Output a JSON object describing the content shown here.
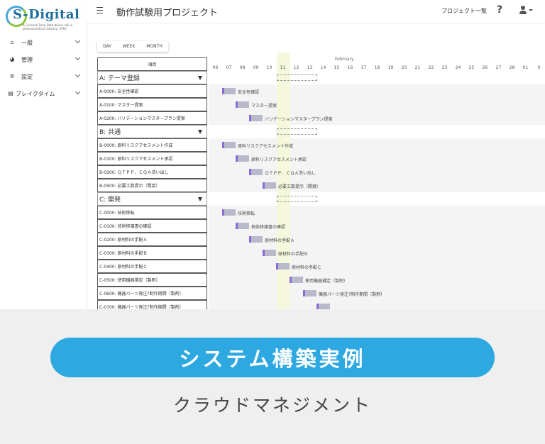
{
  "logo": {
    "text": "S-Digital",
    "tagline": "A Connect Tomo Data-driven eQi in pharmaceutical industry! (IFM)"
  },
  "sidebar": {
    "items": [
      {
        "label": "一般",
        "icon": "home-icon"
      },
      {
        "label": "管理",
        "icon": "palette-icon"
      },
      {
        "label": "設定",
        "icon": "gear-icon"
      },
      {
        "label": "ブレイクタイム",
        "icon": "book-icon"
      }
    ]
  },
  "header": {
    "title": "動作試験用プロジェクト",
    "project_list": "プロジェクト一覧",
    "help": "?"
  },
  "view": {
    "day": "DAY",
    "week": "WEEK",
    "month": "MONTH"
  },
  "table": {
    "header": "項目"
  },
  "month": "February",
  "days": [
    "06",
    "07",
    "08",
    "09",
    "10",
    "11",
    "12",
    "13",
    "14",
    "15",
    "16",
    "17",
    "18",
    "19",
    "20",
    "21",
    "22",
    "23",
    "24",
    "25",
    "26",
    "27",
    "28",
    "01",
    "0"
  ],
  "groups": [
    {
      "label": "A: テーマ登録",
      "tasks": [
        {
          "label": "A-0000: 安全性確認",
          "bar_label": "安全性確認"
        },
        {
          "label": "A-0100: マスター提案",
          "bar_label": "マスター提案"
        },
        {
          "label": "A-0200: バリデーションマスタープラン提案",
          "bar_label": "バリデーションマスタープラン提案"
        }
      ]
    },
    {
      "label": "B: 共通",
      "tasks": [
        {
          "label": "B-0000: 原料リスクアセスメント作成",
          "bar_label": "原料リスクアセスメント作成"
        },
        {
          "label": "B-0100: 原料リスクアセスメント承認",
          "bar_label": "原料リスクアセスメント承認"
        },
        {
          "label": "B-0200: ＱＴＰＰ、ＣＱＡ洗い出し",
          "bar_label": "ＱＴＰＰ、ＣＱＡ洗い出し"
        },
        {
          "label": "B-0500: 必要工数提示（間接）",
          "bar_label": "必要工数提示（間接）"
        }
      ]
    },
    {
      "label": "C: 開発",
      "tasks": [
        {
          "label": "C-0000: 技術移転",
          "bar_label": "技術移転"
        },
        {
          "label": "C-0100: 技術移譲書の確認",
          "bar_label": "技術移譲書の確認"
        },
        {
          "label": "C-0200: 原材料の手配Ａ",
          "bar_label": "原材料の手配Ａ"
        },
        {
          "label": "C-0300: 原材料の手配Ｂ",
          "bar_label": "原材料の手配Ｂ"
        },
        {
          "label": "C-0400: 原材料の手配Ｃ",
          "bar_label": "原材料の手配Ｃ"
        },
        {
          "label": "C-0500: 使用機器選定（製剤）",
          "bar_label": "使用機器選定（製剤）"
        },
        {
          "label": "C-0600: 機器パーツ発注?制作期間（製剤）",
          "bar_label": "機器パーツ発注?制作期間（製剤）"
        },
        {
          "label": "C-0700: 機器パーツ発注?制作期間（製剤）",
          "bar_label": ""
        }
      ]
    }
  ],
  "banner": "システム構築実例",
  "subtitle": "クラウドマネジメント",
  "colors": {
    "accent": "#2da8e1",
    "bar": "#b9b9cc",
    "progress": "#8a6ad8",
    "today": "#f5f8dc"
  }
}
